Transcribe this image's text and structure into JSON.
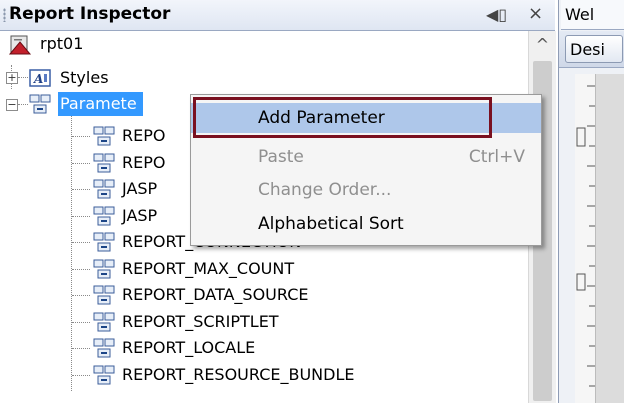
{
  "panel": {
    "title": "Report Inspector",
    "pin_glyph": "◀▯",
    "close_glyph": "×",
    "scroll_up_glyph": "^"
  },
  "tree": {
    "root": {
      "label": "rpt01",
      "icon": "report-icon"
    },
    "styles": {
      "label": "Styles",
      "icon": "styles-icon",
      "expander": "+"
    },
    "parameters": {
      "label": "Paramete",
      "icon": "parameters-icon",
      "expander": "−"
    },
    "items": [
      {
        "label": "REPORT_PARAMETERS_MAP"
      },
      {
        "label": "REPORT_CONTEXT"
      },
      {
        "label": "JASPER_REPORTS_CONTEXT"
      },
      {
        "label": "JASPER_REPORT"
      },
      {
        "label": "REPORT_CONNECTION"
      },
      {
        "label": "REPORT_MAX_COUNT"
      },
      {
        "label": "REPORT_DATA_SOURCE"
      },
      {
        "label": "REPORT_SCRIPTLET"
      },
      {
        "label": "REPORT_LOCALE"
      },
      {
        "label": "REPORT_RESOURCE_BUNDLE"
      }
    ],
    "visible_prefixes": [
      "REPO",
      "REPO",
      "JASP",
      "JASP"
    ]
  },
  "context_menu": {
    "items": [
      {
        "label": "Add Parameter",
        "shortcut": "",
        "enabled": true,
        "highlighted": true
      },
      {
        "label": "Paste",
        "shortcut": "Ctrl+V",
        "enabled": false
      },
      {
        "label": "Change Order...",
        "shortcut": "",
        "enabled": false
      },
      {
        "label": "Alphabetical Sort",
        "shortcut": "",
        "enabled": true
      }
    ]
  },
  "right_pane": {
    "tab_label": "Wel",
    "designer_button": "Desi"
  },
  "colors": {
    "selection": "#3399ff",
    "menu_highlight": "#aec7ea",
    "callout_border": "#7a1020"
  }
}
